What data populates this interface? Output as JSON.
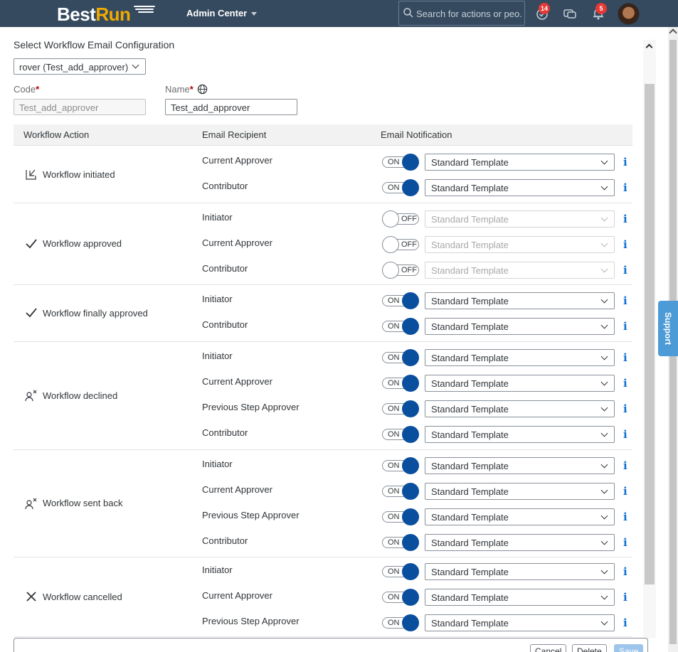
{
  "header": {
    "logo_best": "Best",
    "logo_run": "Run",
    "app_menu": "Admin Center",
    "search_placeholder": "Search for actions or peo...",
    "badges": {
      "tasks": "14",
      "notifications": "5"
    },
    "icons": [
      "search-icon",
      "tasks-icon",
      "chat-icon",
      "bell-icon",
      "avatar"
    ]
  },
  "page": {
    "title": "Select Workflow Email Configuration",
    "config_select": "rover (Test_add_approver)",
    "code_label": "Code",
    "code_value": "Test_add_approver",
    "name_label": "Name",
    "name_value": "Test_add_approver",
    "required_mark": "*"
  },
  "table": {
    "headers": {
      "action": "Workflow Action",
      "recipient": "Email Recipient",
      "notification": "Email Notification"
    },
    "groups": [
      {
        "action": "Workflow initiated",
        "icon": "workflow-initiated-icon",
        "rows": [
          {
            "recipient": "Current Approver",
            "toggle": "ON",
            "template": "Standard Template"
          },
          {
            "recipient": "Contributor",
            "toggle": "ON",
            "template": "Standard Template"
          }
        ]
      },
      {
        "action": "Workflow approved",
        "icon": "checkmark-icon",
        "rows": [
          {
            "recipient": "Initiator",
            "toggle": "OFF",
            "template": "Standard Template"
          },
          {
            "recipient": "Current Approver",
            "toggle": "OFF",
            "template": "Standard Template"
          },
          {
            "recipient": "Contributor",
            "toggle": "OFF",
            "template": "Standard Template"
          }
        ]
      },
      {
        "action": "Workflow finally approved",
        "icon": "checkmark-icon",
        "rows": [
          {
            "recipient": "Initiator",
            "toggle": "ON",
            "template": "Standard Template"
          },
          {
            "recipient": "Contributor",
            "toggle": "ON",
            "template": "Standard Template"
          }
        ]
      },
      {
        "action": "Workflow declined",
        "icon": "person-declined-icon",
        "rows": [
          {
            "recipient": "Initiator",
            "toggle": "ON",
            "template": "Standard Template"
          },
          {
            "recipient": "Current Approver",
            "toggle": "ON",
            "template": "Standard Template"
          },
          {
            "recipient": "Previous Step Approver",
            "toggle": "ON",
            "template": "Standard Template"
          },
          {
            "recipient": "Contributor",
            "toggle": "ON",
            "template": "Standard Template"
          }
        ]
      },
      {
        "action": "Workflow sent back",
        "icon": "person-declined-icon",
        "rows": [
          {
            "recipient": "Initiator",
            "toggle": "ON",
            "template": "Standard Template"
          },
          {
            "recipient": "Current Approver",
            "toggle": "ON",
            "template": "Standard Template"
          },
          {
            "recipient": "Previous Step Approver",
            "toggle": "ON",
            "template": "Standard Template"
          },
          {
            "recipient": "Contributor",
            "toggle": "ON",
            "template": "Standard Template"
          }
        ]
      },
      {
        "action": "Workflow cancelled",
        "icon": "cross-icon",
        "rows": [
          {
            "recipient": "Initiator",
            "toggle": "ON",
            "template": "Standard Template"
          },
          {
            "recipient": "Current Approver",
            "toggle": "ON",
            "template": "Standard Template"
          },
          {
            "recipient": "Previous Step Approver",
            "toggle": "ON",
            "template": "Standard Template"
          }
        ]
      }
    ]
  },
  "footer": {
    "cancel": "Cancel",
    "delete": "Delete",
    "save": "Save"
  },
  "support_tab": "Support",
  "colors": {
    "shell": "#354a5f",
    "accent": "#0a4f9e",
    "info": "#0a6ed1",
    "badge": "#e53935"
  }
}
